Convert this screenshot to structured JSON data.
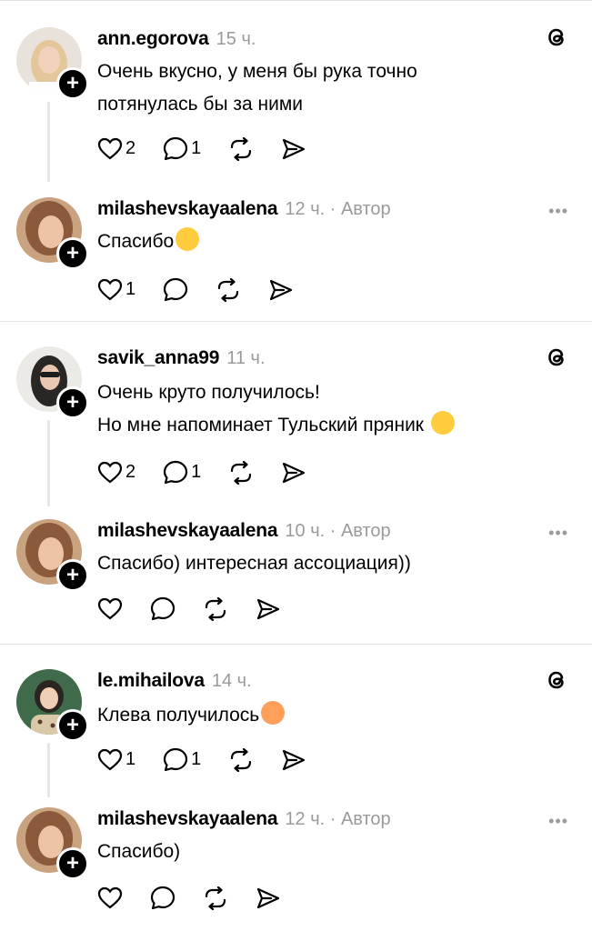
{
  "threads": [
    {
      "post": {
        "username": "ann.egorova",
        "time": "15 ч.",
        "lines": [
          "Очень вкусно, у меня бы рука точно",
          "потянулась бы за ними"
        ],
        "likes": "2",
        "replies": "1"
      },
      "reply": {
        "username": "milashevskayaalena",
        "time": "12 ч. · Автор",
        "lines": [
          "Спасибо"
        ],
        "likes": "1",
        "replies": ""
      }
    },
    {
      "post": {
        "username": "savik_anna99",
        "time": "11 ч.",
        "lines": [
          "Очень круто получилось!",
          "Но мне напоминает Тульский пряник"
        ],
        "likes": "2",
        "replies": "1"
      },
      "reply": {
        "username": "milashevskayaalena",
        "time": "10 ч. · Автор",
        "lines": [
          "Спасибо) интересная ассоциация))"
        ],
        "likes": "",
        "replies": ""
      }
    },
    {
      "post": {
        "username": "le.mihailova",
        "time": "14 ч.",
        "lines": [
          "Клева получилось"
        ],
        "likes": "1",
        "replies": "1"
      },
      "reply": {
        "username": "milashevskayaalena",
        "time": "12 ч. · Автор",
        "lines": [
          "Спасибо)"
        ],
        "likes": "",
        "replies": ""
      }
    }
  ],
  "ui": {
    "more_label": "•••"
  }
}
